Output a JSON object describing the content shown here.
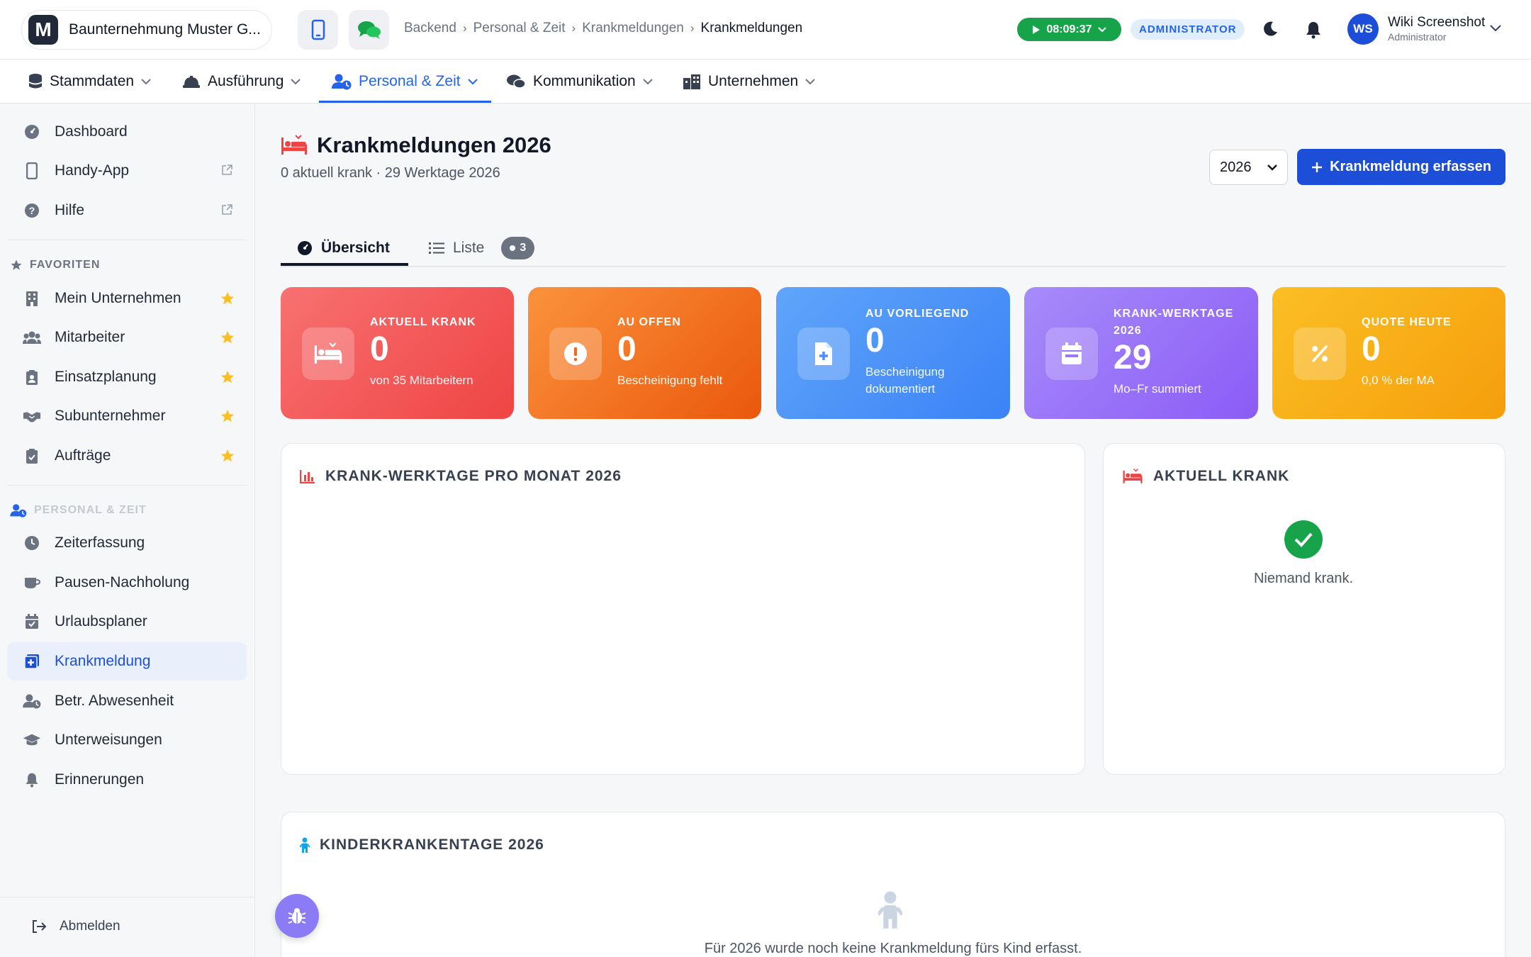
{
  "header": {
    "company_logo_letter": "M",
    "company_name": "Baunternehmung Muster G...",
    "breadcrumb": [
      "Backend",
      "Personal & Zeit",
      "Krankmeldungen",
      "Krankmeldungen"
    ],
    "timer": "08:09:37",
    "role_badge": "ADMINISTRATOR",
    "user_initials": "WS",
    "user_name": "Wiki Screenshot",
    "user_role": "Administrator"
  },
  "mainnav": {
    "items": [
      {
        "label": "Stammdaten",
        "icon": "database-icon"
      },
      {
        "label": "Ausführung",
        "icon": "hardhat-icon"
      },
      {
        "label": "Personal & Zeit",
        "icon": "user-clock-icon",
        "active": true
      },
      {
        "label": "Kommunikation",
        "icon": "comments-icon"
      },
      {
        "label": "Unternehmen",
        "icon": "city-icon"
      }
    ]
  },
  "sidebar": {
    "top_items": [
      {
        "label": "Dashboard",
        "icon": "gauge-icon"
      },
      {
        "label": "Handy-App",
        "icon": "mobile-icon",
        "external": true
      },
      {
        "label": "Hilfe",
        "icon": "question-icon",
        "external": true
      }
    ],
    "favorites_heading": "FAVORITEN",
    "favorites": [
      {
        "label": "Mein Unternehmen",
        "icon": "building-icon"
      },
      {
        "label": "Mitarbeiter",
        "icon": "users-icon"
      },
      {
        "label": "Einsatzplanung",
        "icon": "clipboard-user-icon"
      },
      {
        "label": "Subunternehmer",
        "icon": "handshake-icon"
      },
      {
        "label": "Aufträge",
        "icon": "clipboard-check-icon"
      }
    ],
    "section_heading": "PERSONAL & ZEIT",
    "section_items": [
      {
        "label": "Zeiterfassung",
        "icon": "clock-icon"
      },
      {
        "label": "Pausen-Nachholung",
        "icon": "coffee-icon"
      },
      {
        "label": "Urlaubsplaner",
        "icon": "calendar-check-icon"
      },
      {
        "label": "Krankmeldung",
        "icon": "notes-medical-icon",
        "active": true
      },
      {
        "label": "Betr. Abwesenheit",
        "icon": "user-clock-icon"
      },
      {
        "label": "Unterweisungen",
        "icon": "graduation-cap-icon"
      },
      {
        "label": "Erinnerungen",
        "icon": "bell-icon"
      }
    ],
    "logout_label": "Abmelden"
  },
  "page": {
    "title": "Krankmeldungen 2026",
    "subtitle": "0 aktuell krank · 29 Werktage 2026",
    "year_selected": "2026",
    "primary_button": "Krankmeldung erfassen",
    "tabs": [
      {
        "label": "Übersicht",
        "active": true
      },
      {
        "label": "Liste",
        "badge": "3"
      }
    ]
  },
  "stats": [
    {
      "label": "AKTUELL KRANK",
      "value": "0",
      "desc": "von 35 Mitarbeitern",
      "icon": "bed-icon",
      "color": "#ef4444"
    },
    {
      "label": "AU OFFEN",
      "value": "0",
      "desc": "Bescheinigung fehlt",
      "icon": "exclamation-icon",
      "color": "#f97316"
    },
    {
      "label": "AU VORLIEGEND",
      "value": "0",
      "desc": "Bescheinigung dokumentiert",
      "icon": "file-medical-icon",
      "color": "#3b82f6"
    },
    {
      "label": "KRANK-WERKTAGE 2026",
      "value": "29",
      "desc": "Mo–Fr summiert",
      "icon": "calendar-icon",
      "color": "#8b5cf6"
    },
    {
      "label": "QUOTE HEUTE",
      "value": "0",
      "desc": "0,0 % der MA",
      "icon": "percent-icon",
      "color": "#f59e0b"
    }
  ],
  "cards": {
    "chart_title": "KRANK-WERKTAGE PRO MONAT 2026",
    "current_title": "AKTUELL KRANK",
    "current_empty": "Niemand krank.",
    "kid_title": "KINDERKRANKENTAGE 2026",
    "kid_empty": "Für 2026 wurde noch keine Krankmeldung fürs Kind erfasst."
  }
}
